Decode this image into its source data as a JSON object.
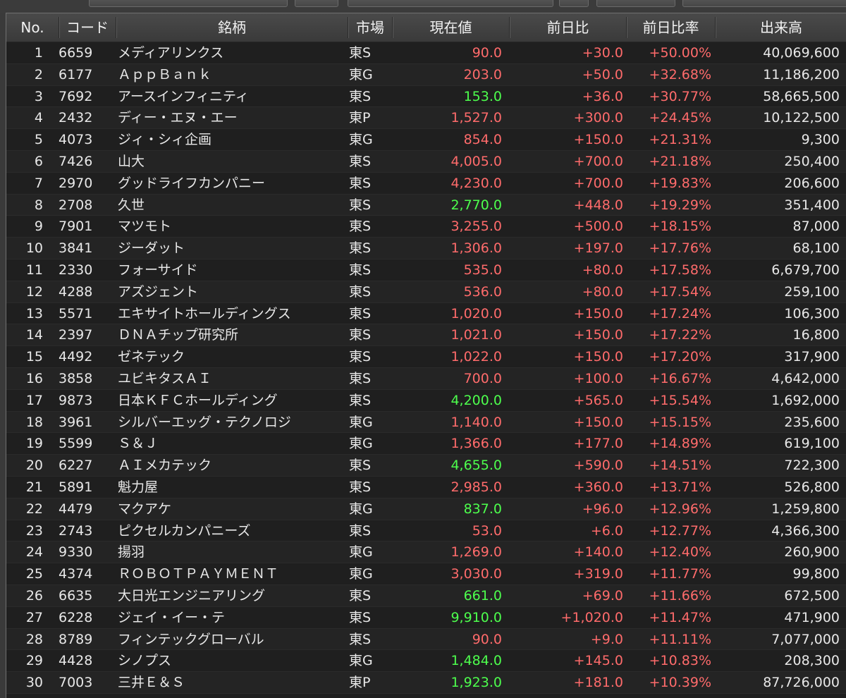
{
  "headers": {
    "no": "No.",
    "code": "コード",
    "name": "銘柄",
    "market": "市場",
    "price": "現在値",
    "change": "前日比",
    "change_pct": "前日比率",
    "volume": "出来高"
  },
  "colors": {
    "up": "#ff6b6b",
    "highlight": "#4dff4d",
    "text": "#e8e8e8"
  },
  "rows": [
    {
      "no": "1",
      "code": "6659",
      "name": "メディアリンクス",
      "market": "東S",
      "price": "90.0",
      "price_color": "red",
      "change": "+30.0",
      "change_pct": "+50.00%",
      "volume": "40,069,600"
    },
    {
      "no": "2",
      "code": "6177",
      "name": "ＡｐｐＢａｎｋ",
      "market": "東G",
      "price": "203.0",
      "price_color": "red",
      "change": "+50.0",
      "change_pct": "+32.68%",
      "volume": "11,186,200"
    },
    {
      "no": "3",
      "code": "7692",
      "name": "アースインフィニティ",
      "market": "東S",
      "price": "153.0",
      "price_color": "green",
      "change": "+36.0",
      "change_pct": "+30.77%",
      "volume": "58,665,500"
    },
    {
      "no": "4",
      "code": "2432",
      "name": "ディー・エヌ・エー",
      "market": "東P",
      "price": "1,527.0",
      "price_color": "red",
      "change": "+300.0",
      "change_pct": "+24.45%",
      "volume": "10,122,500"
    },
    {
      "no": "5",
      "code": "4073",
      "name": "ジィ・シィ企画",
      "market": "東G",
      "price": "854.0",
      "price_color": "red",
      "change": "+150.0",
      "change_pct": "+21.31%",
      "volume": "9,300"
    },
    {
      "no": "6",
      "code": "7426",
      "name": "山大",
      "market": "東S",
      "price": "4,005.0",
      "price_color": "red",
      "change": "+700.0",
      "change_pct": "+21.18%",
      "volume": "250,400"
    },
    {
      "no": "7",
      "code": "2970",
      "name": "グッドライフカンパニー",
      "market": "東S",
      "price": "4,230.0",
      "price_color": "red",
      "change": "+700.0",
      "change_pct": "+19.83%",
      "volume": "206,600"
    },
    {
      "no": "8",
      "code": "2708",
      "name": "久世",
      "market": "東S",
      "price": "2,770.0",
      "price_color": "green",
      "change": "+448.0",
      "change_pct": "+19.29%",
      "volume": "351,400"
    },
    {
      "no": "9",
      "code": "7901",
      "name": "マツモト",
      "market": "東S",
      "price": "3,255.0",
      "price_color": "red",
      "change": "+500.0",
      "change_pct": "+18.15%",
      "volume": "87,000"
    },
    {
      "no": "10",
      "code": "3841",
      "name": "ジーダット",
      "market": "東S",
      "price": "1,306.0",
      "price_color": "red",
      "change": "+197.0",
      "change_pct": "+17.76%",
      "volume": "68,100"
    },
    {
      "no": "11",
      "code": "2330",
      "name": "フォーサイド",
      "market": "東S",
      "price": "535.0",
      "price_color": "red",
      "change": "+80.0",
      "change_pct": "+17.58%",
      "volume": "6,679,700"
    },
    {
      "no": "12",
      "code": "4288",
      "name": "アズジェント",
      "market": "東S",
      "price": "536.0",
      "price_color": "red",
      "change": "+80.0",
      "change_pct": "+17.54%",
      "volume": "259,100"
    },
    {
      "no": "13",
      "code": "5571",
      "name": "エキサイトホールディングス",
      "market": "東S",
      "price": "1,020.0",
      "price_color": "red",
      "change": "+150.0",
      "change_pct": "+17.24%",
      "volume": "106,300"
    },
    {
      "no": "14",
      "code": "2397",
      "name": "ＤＮＡチップ研究所",
      "market": "東S",
      "price": "1,021.0",
      "price_color": "red",
      "change": "+150.0",
      "change_pct": "+17.22%",
      "volume": "16,800"
    },
    {
      "no": "15",
      "code": "4492",
      "name": "ゼネテック",
      "market": "東S",
      "price": "1,022.0",
      "price_color": "red",
      "change": "+150.0",
      "change_pct": "+17.20%",
      "volume": "317,900"
    },
    {
      "no": "16",
      "code": "3858",
      "name": "ユビキタスＡＩ",
      "market": "東S",
      "price": "700.0",
      "price_color": "red",
      "change": "+100.0",
      "change_pct": "+16.67%",
      "volume": "4,642,000"
    },
    {
      "no": "17",
      "code": "9873",
      "name": "日本ＫＦＣホールディング",
      "market": "東S",
      "price": "4,200.0",
      "price_color": "green",
      "change": "+565.0",
      "change_pct": "+15.54%",
      "volume": "1,692,000"
    },
    {
      "no": "18",
      "code": "3961",
      "name": "シルバーエッグ・テクノロジ",
      "market": "東G",
      "price": "1,140.0",
      "price_color": "red",
      "change": "+150.0",
      "change_pct": "+15.15%",
      "volume": "235,600"
    },
    {
      "no": "19",
      "code": "5599",
      "name": "Ｓ＆Ｊ",
      "market": "東G",
      "price": "1,366.0",
      "price_color": "red",
      "change": "+177.0",
      "change_pct": "+14.89%",
      "volume": "619,100"
    },
    {
      "no": "20",
      "code": "6227",
      "name": "ＡＩメカテック",
      "market": "東S",
      "price": "4,655.0",
      "price_color": "green",
      "change": "+590.0",
      "change_pct": "+14.51%",
      "volume": "722,300"
    },
    {
      "no": "21",
      "code": "5891",
      "name": "魁力屋",
      "market": "東S",
      "price": "2,985.0",
      "price_color": "red",
      "change": "+360.0",
      "change_pct": "+13.71%",
      "volume": "526,800"
    },
    {
      "no": "22",
      "code": "4479",
      "name": "マクアケ",
      "market": "東G",
      "price": "837.0",
      "price_color": "green",
      "change": "+96.0",
      "change_pct": "+12.96%",
      "volume": "1,259,800"
    },
    {
      "no": "23",
      "code": "2743",
      "name": "ピクセルカンパニーズ",
      "market": "東S",
      "price": "53.0",
      "price_color": "red",
      "change": "+6.0",
      "change_pct": "+12.77%",
      "volume": "4,366,300"
    },
    {
      "no": "24",
      "code": "9330",
      "name": "揚羽",
      "market": "東G",
      "price": "1,269.0",
      "price_color": "red",
      "change": "+140.0",
      "change_pct": "+12.40%",
      "volume": "260,900"
    },
    {
      "no": "25",
      "code": "4374",
      "name": "ＲＯＢＯＴＰＡＹＭＥＮＴ",
      "market": "東G",
      "price": "3,030.0",
      "price_color": "red",
      "change": "+319.0",
      "change_pct": "+11.77%",
      "volume": "99,800"
    },
    {
      "no": "26",
      "code": "6635",
      "name": "大日光エンジニアリング",
      "market": "東S",
      "price": "661.0",
      "price_color": "green",
      "change": "+69.0",
      "change_pct": "+11.66%",
      "volume": "672,500"
    },
    {
      "no": "27",
      "code": "6228",
      "name": "ジェイ・イー・テ",
      "market": "東S",
      "price": "9,910.0",
      "price_color": "green",
      "change": "+1,020.0",
      "change_pct": "+11.47%",
      "volume": "471,900"
    },
    {
      "no": "28",
      "code": "8789",
      "name": "フィンテックグローバル",
      "market": "東S",
      "price": "90.0",
      "price_color": "red",
      "change": "+9.0",
      "change_pct": "+11.11%",
      "volume": "7,077,000"
    },
    {
      "no": "29",
      "code": "4428",
      "name": "シノプス",
      "market": "東G",
      "price": "1,484.0",
      "price_color": "green",
      "change": "+145.0",
      "change_pct": "+10.83%",
      "volume": "208,300"
    },
    {
      "no": "30",
      "code": "7003",
      "name": "三井Ｅ＆Ｓ",
      "market": "東P",
      "price": "1,923.0",
      "price_color": "green",
      "change": "+181.0",
      "change_pct": "+10.39%",
      "volume": "87,726,000"
    }
  ]
}
